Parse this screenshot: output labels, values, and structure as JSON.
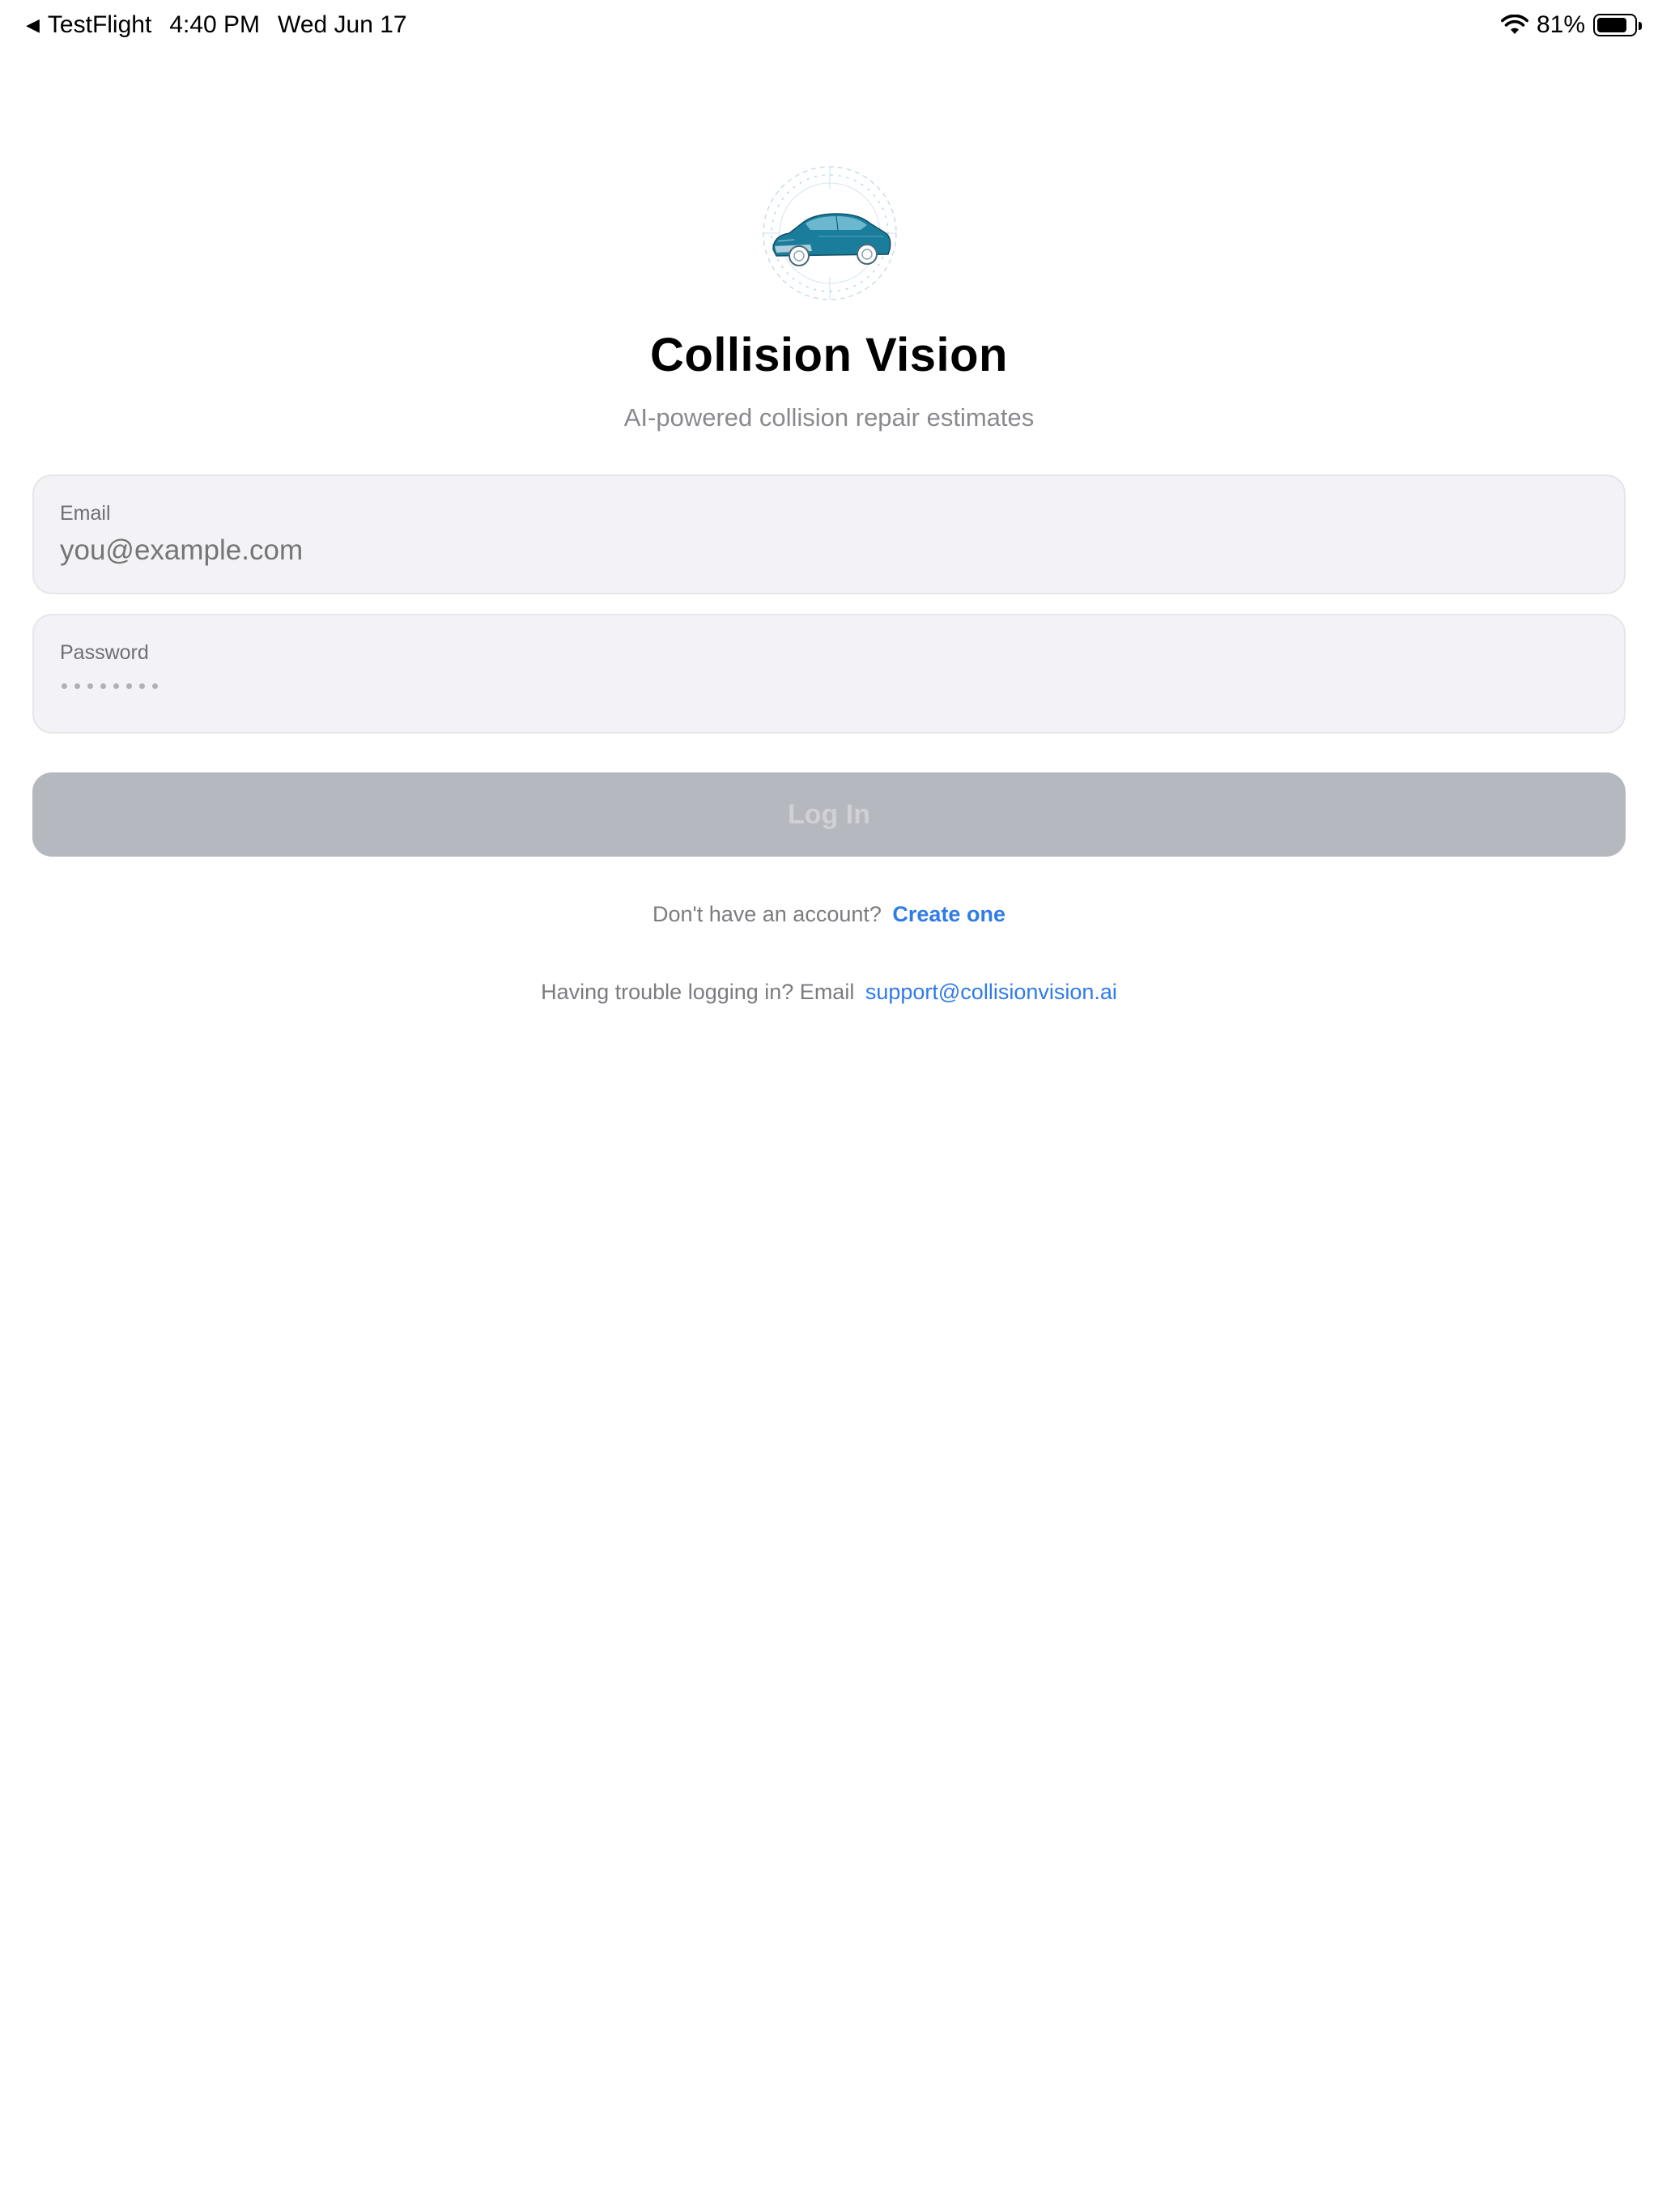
{
  "status_bar": {
    "back_app": "TestFlight",
    "time": "4:40 PM",
    "date": "Wed Jun 17",
    "battery_percent_label": "81%",
    "battery_level": 0.81,
    "icons": [
      "back-arrow-icon",
      "wifi-icon",
      "battery-icon"
    ]
  },
  "header": {
    "logo": "car-logo-icon",
    "title": "Collision Vision",
    "subtitle": "AI-powered collision repair estimates"
  },
  "form": {
    "email": {
      "label": "Email",
      "placeholder": "you@example.com",
      "value": ""
    },
    "password": {
      "label": "Password",
      "value": ""
    },
    "login_button": "Log In"
  },
  "footer": {
    "signup_prompt": "Don't have an account?",
    "signup_link": "Create one",
    "support_prompt": "Having trouble logging in? Email",
    "support_link": "support@collisionvision.ai"
  },
  "colors": {
    "accent": "#2f7be8",
    "field_background": "#f2f2f7",
    "button_disabled": "#b6b8bf",
    "secondary_text": "#8a8a8e"
  }
}
